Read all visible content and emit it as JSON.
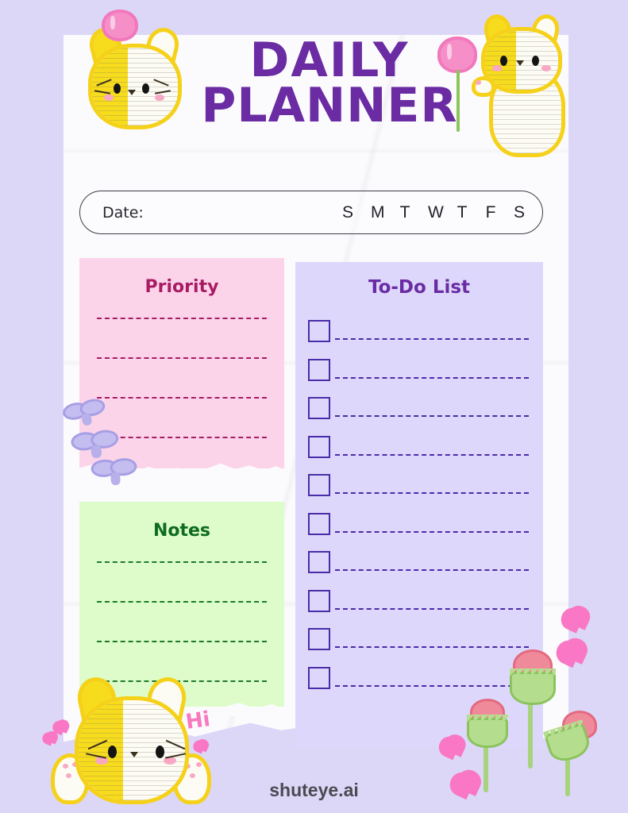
{
  "header": {
    "title_line1": "DAILY",
    "title_line2": "PLANNER"
  },
  "date_bar": {
    "label": "Date:",
    "weekdays": [
      "S",
      "M",
      "T",
      "W",
      "T",
      "F",
      "S"
    ]
  },
  "panels": {
    "priority": {
      "title": "Priority",
      "line_count": 4
    },
    "notes": {
      "title": "Notes",
      "line_count": 4
    },
    "todo": {
      "title": "To-Do List",
      "checkbox_count": 10
    }
  },
  "decorations": {
    "greeting": "Hi"
  },
  "footer": {
    "brand": "shuteye.ai"
  },
  "colors": {
    "background": "#dcd7f7",
    "sheet": "#fbfbfd",
    "title_purple": "#6a2ba3",
    "priority_panel": "#fcd4ea",
    "priority_accent": "#a81b64",
    "notes_panel": "#ddfcc9",
    "notes_accent": "#0f6b1f",
    "todo_panel": "#ddd8fb",
    "todo_accent": "#4b2ca8",
    "footer_text": "#4a4a52",
    "cat_yellow": "#f7dc1e",
    "heart_pink": "#f977c4"
  }
}
